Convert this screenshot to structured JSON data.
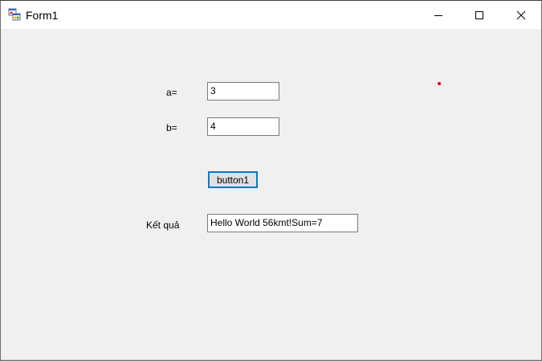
{
  "window": {
    "title": "Form1",
    "icon": "winforms-app-icon",
    "caption_buttons": [
      "minimize-icon",
      "maximize-icon",
      "close-icon"
    ]
  },
  "form": {
    "label_a": "a=",
    "input_a_value": "3",
    "label_b": "b=",
    "input_b_value": "4",
    "button_label": "button1",
    "label_result": "Kết quả",
    "result_value": "Hello World 56kmt!Sum=7"
  },
  "colors": {
    "focus_border": "#0078d7",
    "marker_dot": "#e00000"
  }
}
